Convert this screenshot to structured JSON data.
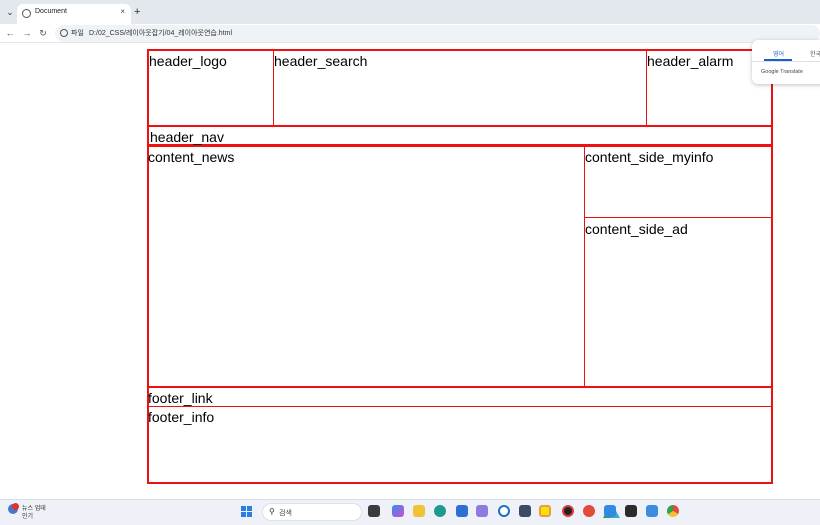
{
  "browser": {
    "tab_title": "Document",
    "new_tab_glyph": "+",
    "close_glyph": "×",
    "tab_search_glyph": "⌄",
    "back_glyph": "←",
    "forward_glyph": "→",
    "reload_glyph": "↻",
    "address_label": "파일",
    "url": "D:/02_CSS/레이아웃잡기/04_레이아웃연습.html"
  },
  "translate_popup": {
    "tab_source": "영어",
    "tab_target": "한국",
    "brand": "Google Translate"
  },
  "page": {
    "boxes": {
      "header_logo": "header_logo",
      "header_search": "header_search",
      "header_alarm": "header_alarm",
      "header_nav": "header_nav",
      "content_news": "content_news",
      "content_side_myinfo": "content_side_myinfo",
      "content_side_ad": "content_side_ad",
      "footer_link": "footer_link",
      "footer_info": "footer_info"
    },
    "border_color": "#ee1111"
  },
  "taskbar": {
    "weather_line1": "뉴스 업데",
    "weather_line2": "인기",
    "search_placeholder": "검색",
    "accent": "#2a7fe0",
    "icons": [
      "art-icon",
      "file-explorer-icon",
      "copilot-icon",
      "folder-icon",
      "edge-icon",
      "store-icon",
      "app-icon",
      "circle-app-icon",
      "monitor-icon",
      "kakaotalk-icon",
      "record-icon",
      "chrome-badge-icon",
      "vscode-icon",
      "terminal-icon",
      "phone-link-icon",
      "chrome-icon"
    ]
  }
}
